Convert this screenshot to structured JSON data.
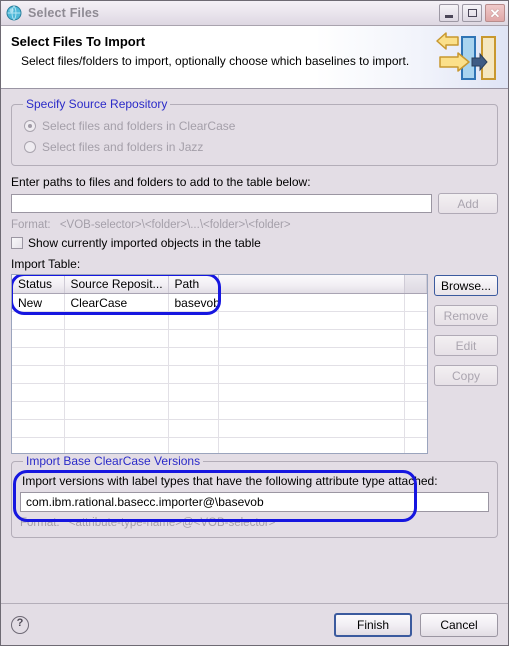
{
  "window": {
    "title": "Select Files",
    "title_icon": "globe-icon",
    "controls": {
      "minimize": "minimize-icon",
      "maximize": "maximize-icon",
      "close": "close-icon"
    }
  },
  "banner": {
    "title": "Select Files To Import",
    "subtitle": "Select files/folders to import, optionally choose which baselines to import.",
    "icon": "import-arrows-icon"
  },
  "source_repository": {
    "legend": "Specify Source Repository",
    "options": [
      {
        "label": "Select files and folders in ClearCase",
        "selected": true,
        "disabled": true
      },
      {
        "label": "Select files and folders in Jazz",
        "selected": false,
        "disabled": true
      }
    ]
  },
  "paths": {
    "label": "Enter paths to files and folders to add to the table below:",
    "input_value": "",
    "input_placeholder": "",
    "add_button": "Add",
    "add_disabled": true,
    "format_label": "Format:",
    "format_value": "<VOB-selector>\\<folder>\\...\\<folder>\\<folder>",
    "checkbox_label": "Show currently imported objects in the table",
    "checkbox_checked": false
  },
  "import_table": {
    "label": "Import Table:",
    "columns": [
      "Status",
      "Source Reposit...",
      "Path",
      "",
      ""
    ],
    "rows": [
      [
        "New",
        "ClearCase",
        "basevob",
        "",
        ""
      ]
    ],
    "empty_row_count": 11,
    "buttons": [
      {
        "label": "Browse...",
        "disabled": false,
        "focused": true
      },
      {
        "label": "Remove",
        "disabled": true,
        "focused": false
      },
      {
        "label": "Edit",
        "disabled": true,
        "focused": false
      },
      {
        "label": "Copy",
        "disabled": true,
        "focused": false
      }
    ]
  },
  "base_versions": {
    "legend": "Import Base ClearCase Versions",
    "instruction": "Import versions with label types that have the following attribute type attached:",
    "attribute_value": "com.ibm.rational.basecc.importer@\\basevob",
    "format_label": "Format:",
    "format_value": "<attribute-type-name>@<VOB-selector>"
  },
  "footer": {
    "help_icon": "help-icon",
    "finish_label": "Finish",
    "cancel_label": "Cancel"
  },
  "annotations": {
    "accent_color": "#1616e0",
    "ring_table": "highlight-import-table-row",
    "ring_attribute": "highlight-attribute-field"
  }
}
